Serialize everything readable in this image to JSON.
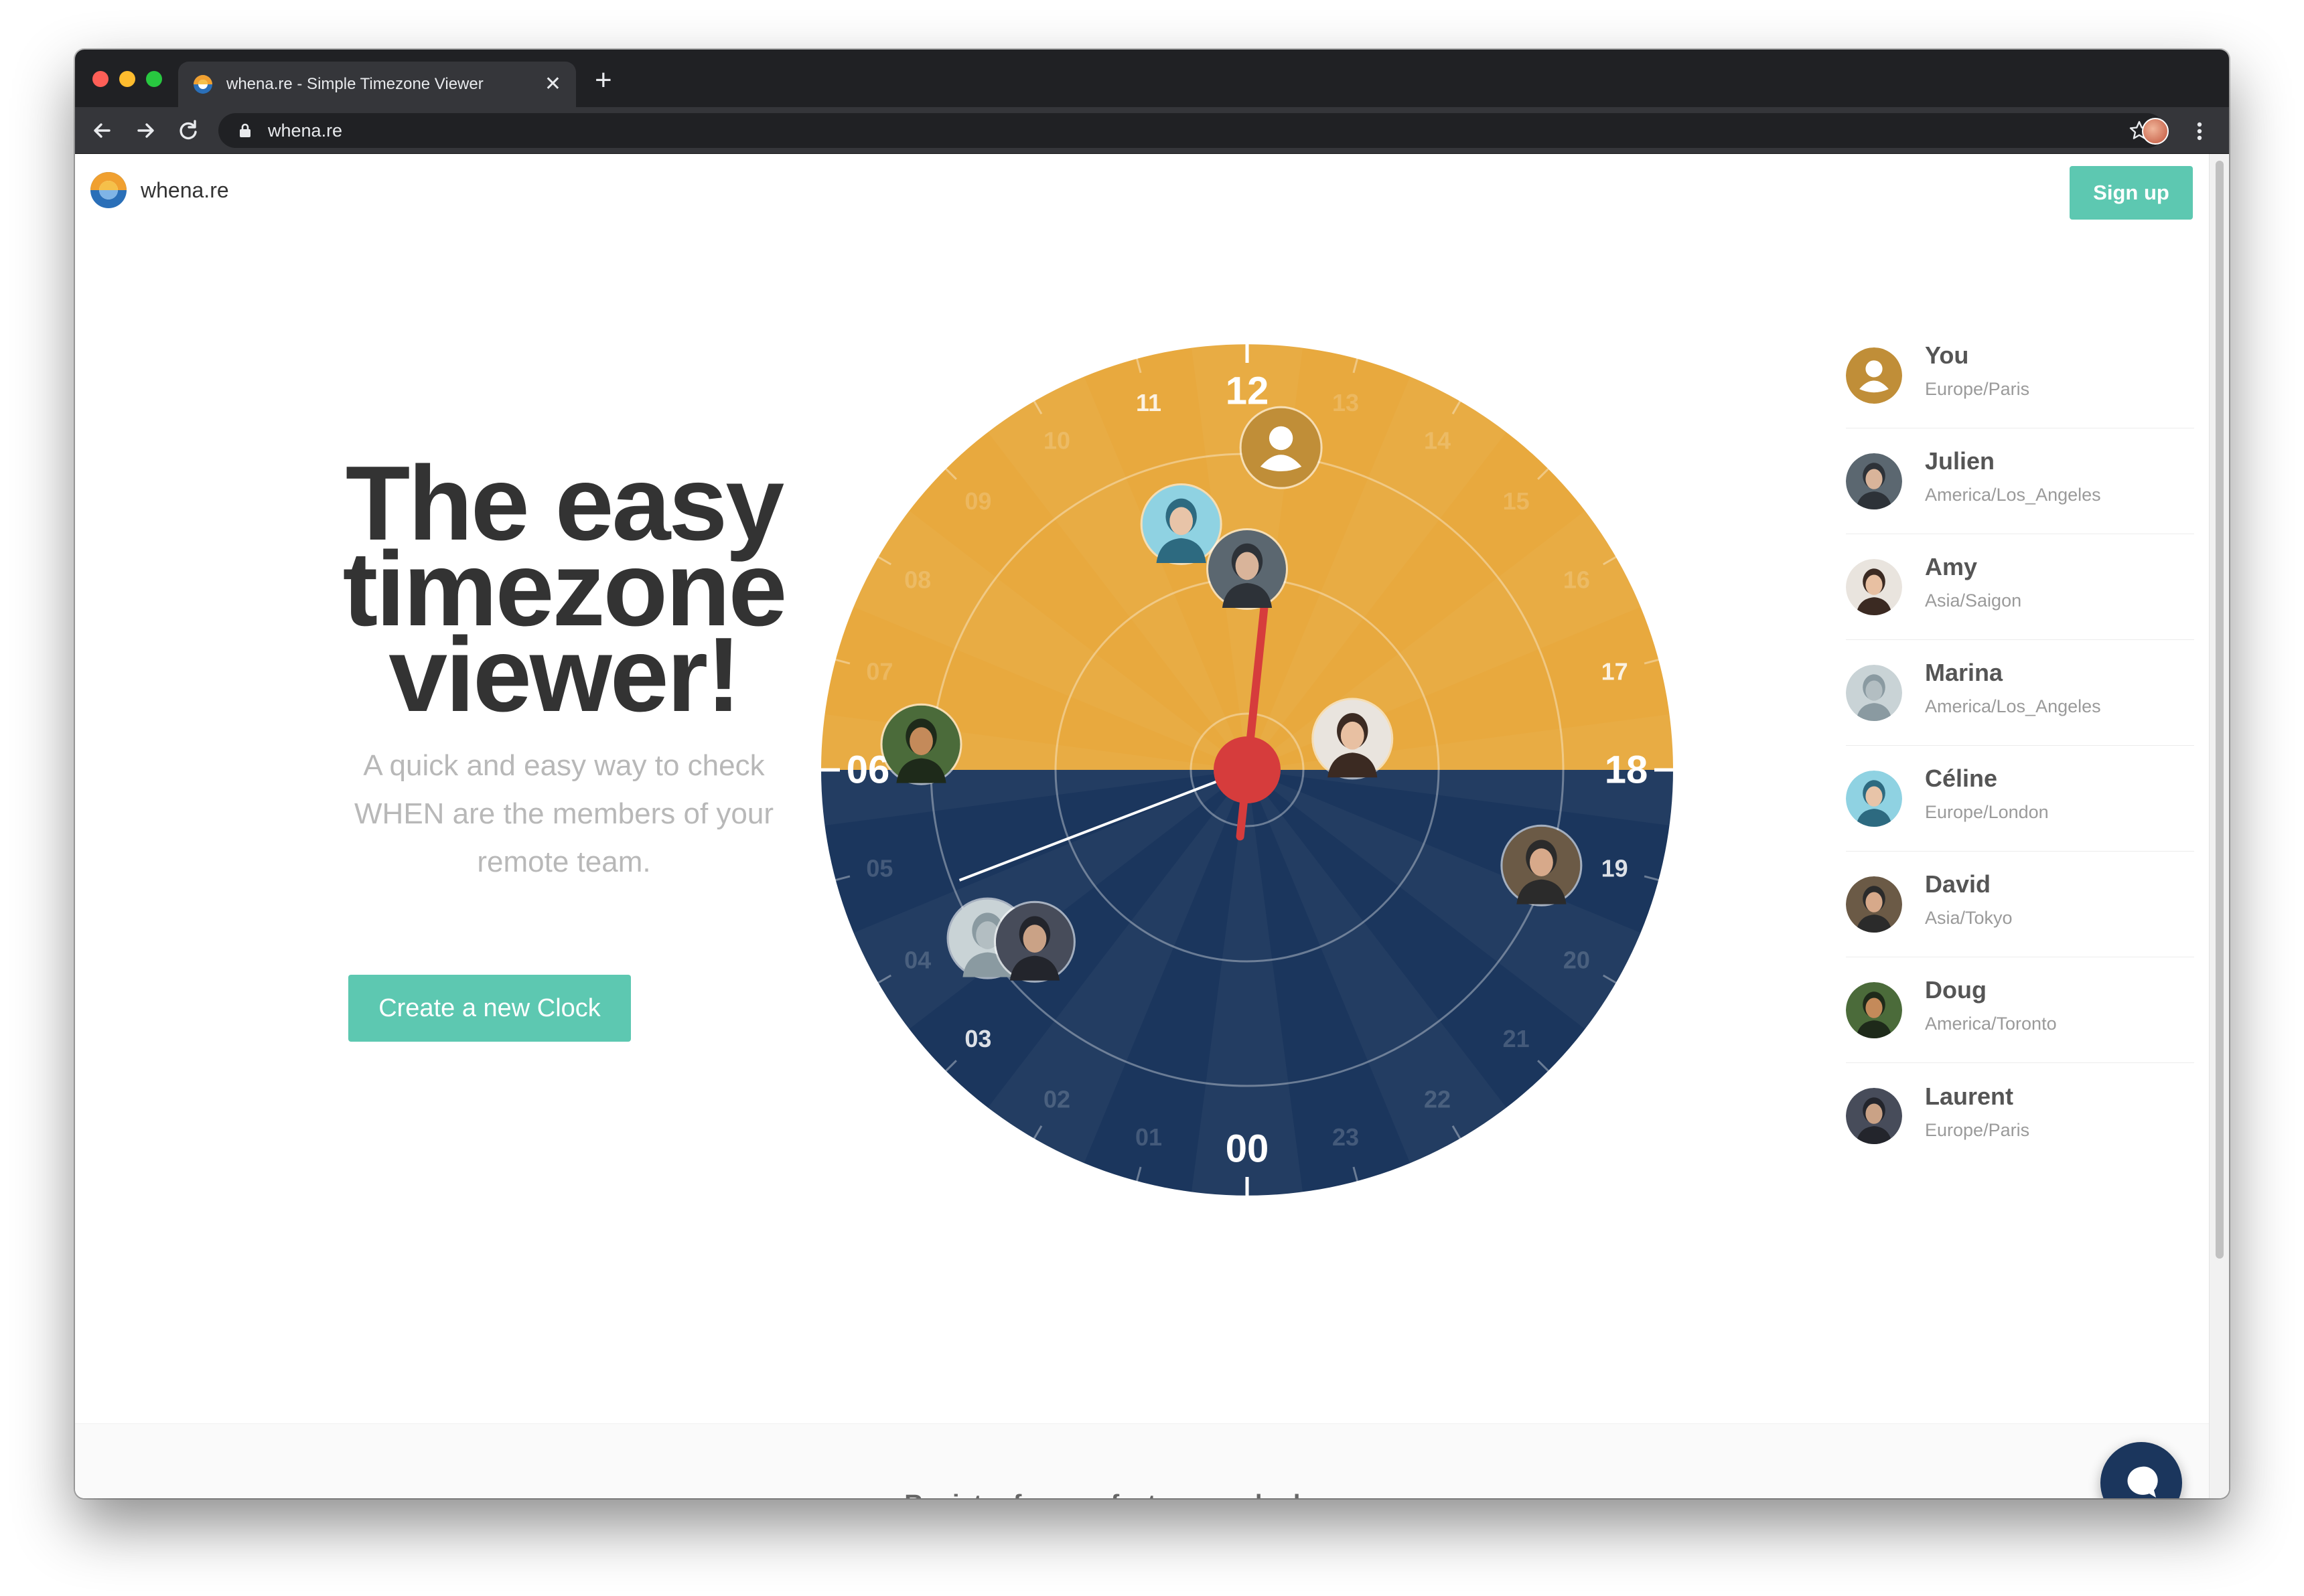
{
  "browser": {
    "tab_title": "whena.re - Simple Timezone Viewer",
    "url": "whena.re",
    "close_glyph": "✕",
    "new_tab_glyph": "+"
  },
  "header": {
    "brand_name": "whena.re",
    "signup_label": "Sign up"
  },
  "hero": {
    "title_lines": [
      "The easy",
      "timezone",
      "viewer!"
    ],
    "subtitle_lines": [
      "A quick and easy way to check",
      "WHEN are the members of your",
      "remote team."
    ],
    "cta_label": "Create a new Clock"
  },
  "clock": {
    "hours_major": [
      "00",
      "06",
      "12",
      "18"
    ],
    "hours_minor": [
      "01",
      "02",
      "03",
      "04",
      "05",
      "07",
      "08",
      "09",
      "10",
      "11",
      "13",
      "14",
      "15",
      "16",
      "17",
      "19",
      "20",
      "21",
      "22",
      "23"
    ],
    "highlighted_hours": [
      "03",
      "11",
      "17",
      "19"
    ],
    "day_color": "#e8a93e",
    "night_color": "#1b365d",
    "hand_color": "#d63c3c",
    "hour_hand": 12.4,
    "minute_hand": 4.6
  },
  "members": [
    {
      "name": "You",
      "timezone": "Europe/Paris",
      "avatar": "user-icon",
      "hour": 12.4
    },
    {
      "name": "Julien",
      "timezone": "America/Los_Angeles",
      "avatar": "photo",
      "hour": 12.0
    },
    {
      "name": "Amy",
      "timezone": "Asia/Saigon",
      "avatar": "photo",
      "hour": 16.9
    },
    {
      "name": "Marina",
      "timezone": "America/Los_Angeles",
      "avatar": "photo",
      "hour": 3.8
    },
    {
      "name": "Céline",
      "timezone": "Europe/London",
      "avatar": "photo",
      "hour": 11.0
    },
    {
      "name": "David",
      "timezone": "Asia/Tokyo",
      "avatar": "photo",
      "hour": 19.2
    },
    {
      "name": "Doug",
      "timezone": "America/Toronto",
      "avatar": "photo",
      "hour": 6.3
    },
    {
      "name": "Laurent",
      "timezone": "Europe/Paris",
      "avatar": "photo",
      "hour": 3.4
    }
  ],
  "footer": {
    "register_text": "Register for new features and releases:"
  },
  "colors": {
    "accent": "#5dc8b1",
    "text_dark": "#333333",
    "chat": "#1b365d"
  }
}
